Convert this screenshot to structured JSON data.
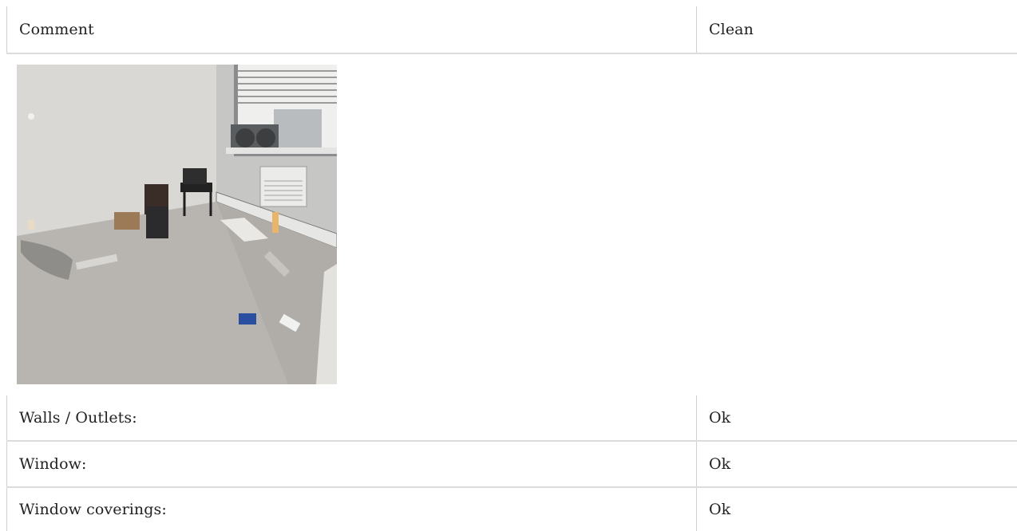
{
  "header": {
    "comment_label": "Comment",
    "clean_label": "Clean"
  },
  "photo": {
    "icon": "room-photo",
    "colors": {
      "wall": "#d6d5d1",
      "carpet": "#b9b6b0",
      "window_light": "#f4f4f2"
    }
  },
  "rows": [
    {
      "label": "Walls / Outlets:",
      "value": "Ok"
    },
    {
      "label": "Window:",
      "value": "Ok"
    },
    {
      "label": "Window coverings:",
      "value": "Ok"
    }
  ]
}
